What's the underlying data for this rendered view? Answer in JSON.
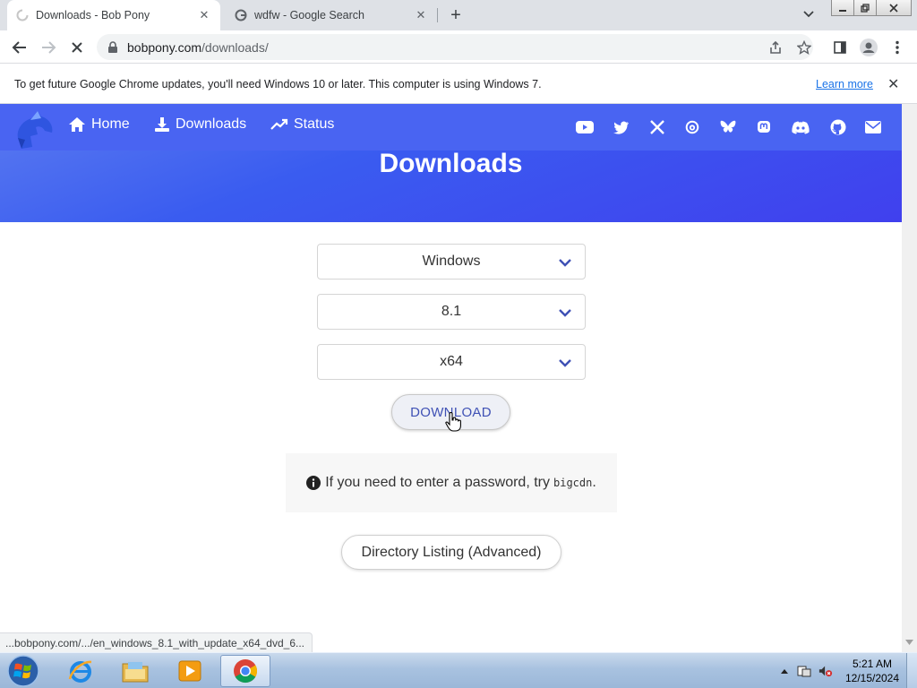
{
  "browser": {
    "tabs": [
      {
        "title": "Downloads - Bob Pony",
        "active": true
      },
      {
        "title": "wdfw - Google Search",
        "active": false
      }
    ],
    "new_tab_glyph": "+",
    "close_glyph": "✕",
    "url_host": "bobpony.com",
    "url_path": "/downloads/"
  },
  "infobar": {
    "message": "To get future Google Chrome updates, you'll need Windows 10 or later. This computer is using Windows 7.",
    "learn_more": "Learn more"
  },
  "site": {
    "nav": [
      {
        "label": "Home",
        "icon": "home-icon"
      },
      {
        "label": "Downloads",
        "icon": "download-icon"
      },
      {
        "label": "Status",
        "icon": "trending-up-icon"
      }
    ],
    "social_icons": [
      "youtube-icon",
      "twitter-icon",
      "x-icon",
      "threads-icon",
      "bluesky-icon",
      "mastodon-icon",
      "discord-icon",
      "github-icon",
      "email-icon"
    ],
    "hero_title": "Downloads",
    "brand_color": "#4964f2"
  },
  "form": {
    "os_select": "Windows",
    "version_select": "8.1",
    "arch_select": "x64",
    "download_label": "DOWNLOAD",
    "notice_text": "If you need to enter a password, try",
    "notice_code": "bigcdn",
    "notice_end": ".",
    "directory_label": "Directory Listing (Advanced)"
  },
  "status_url": "...bobpony.com/.../en_windows_8.1_with_update_x64_dvd_6...",
  "taskbar": {
    "time": "5:21 AM",
    "date": "12/15/2024"
  }
}
